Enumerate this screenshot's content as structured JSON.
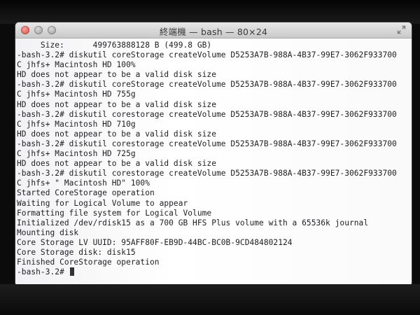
{
  "window": {
    "title": "終端機 — bash — 80×24"
  },
  "terminal": {
    "lines": [
      "     Size:      499763888128 B (499.8 GB)",
      "-bash-3.2# diskutil coreStorage createVolume D5253A7B-988A-4B37-99E7-3062F933700",
      "C jhfs+ Macintosh HD 100%",
      "HD does not appear to be a valid disk size",
      "-bash-3.2# diskutil coreStorage createVolume D5253A7B-988A-4B37-99E7-3062F933700",
      "C jhfs+ Macintosh HD 755g",
      "HD does not appear to be a valid disk size",
      "-bash-3.2# diskutil corestorage createVolume D5253A7B-988A-4B37-99E7-3062F933700",
      "C jhfs+ Macintosh HD 710g",
      "HD does not appear to be a valid disk size",
      "-bash-3.2# diskutil corestorage createVolume D5253A7B-988A-4B37-99E7-3062F933700",
      "C jhfs+ Macintosh HD 725g",
      "HD does not appear to be a valid disk size",
      "-bash-3.2# diskutil corestorage createVolume D5253A7B-988A-4B37-99E7-3062F933700",
      "C jhfs+ \" Macintosh HD\" 100%",
      "Started CoreStorage operation",
      "Waiting for Logical Volume to appear",
      "Formatting file system for Logical Volume",
      "Initialized /dev/rdisk15 as a 700 GB HFS Plus volume with a 65536k journal",
      "Mounting disk",
      "Core Storage LV UUID: 95AFF80F-EB9D-44BC-BC0B-9CD484802124",
      "Core Storage disk: disk15",
      "Finished CoreStorage operation"
    ],
    "prompt": "-bash-3.2# "
  },
  "icons": {
    "close": "close-button-icon",
    "minimize": "minimize-button-icon",
    "zoom": "zoom-button-icon",
    "fullscreen": "fullscreen-arrows-icon"
  }
}
